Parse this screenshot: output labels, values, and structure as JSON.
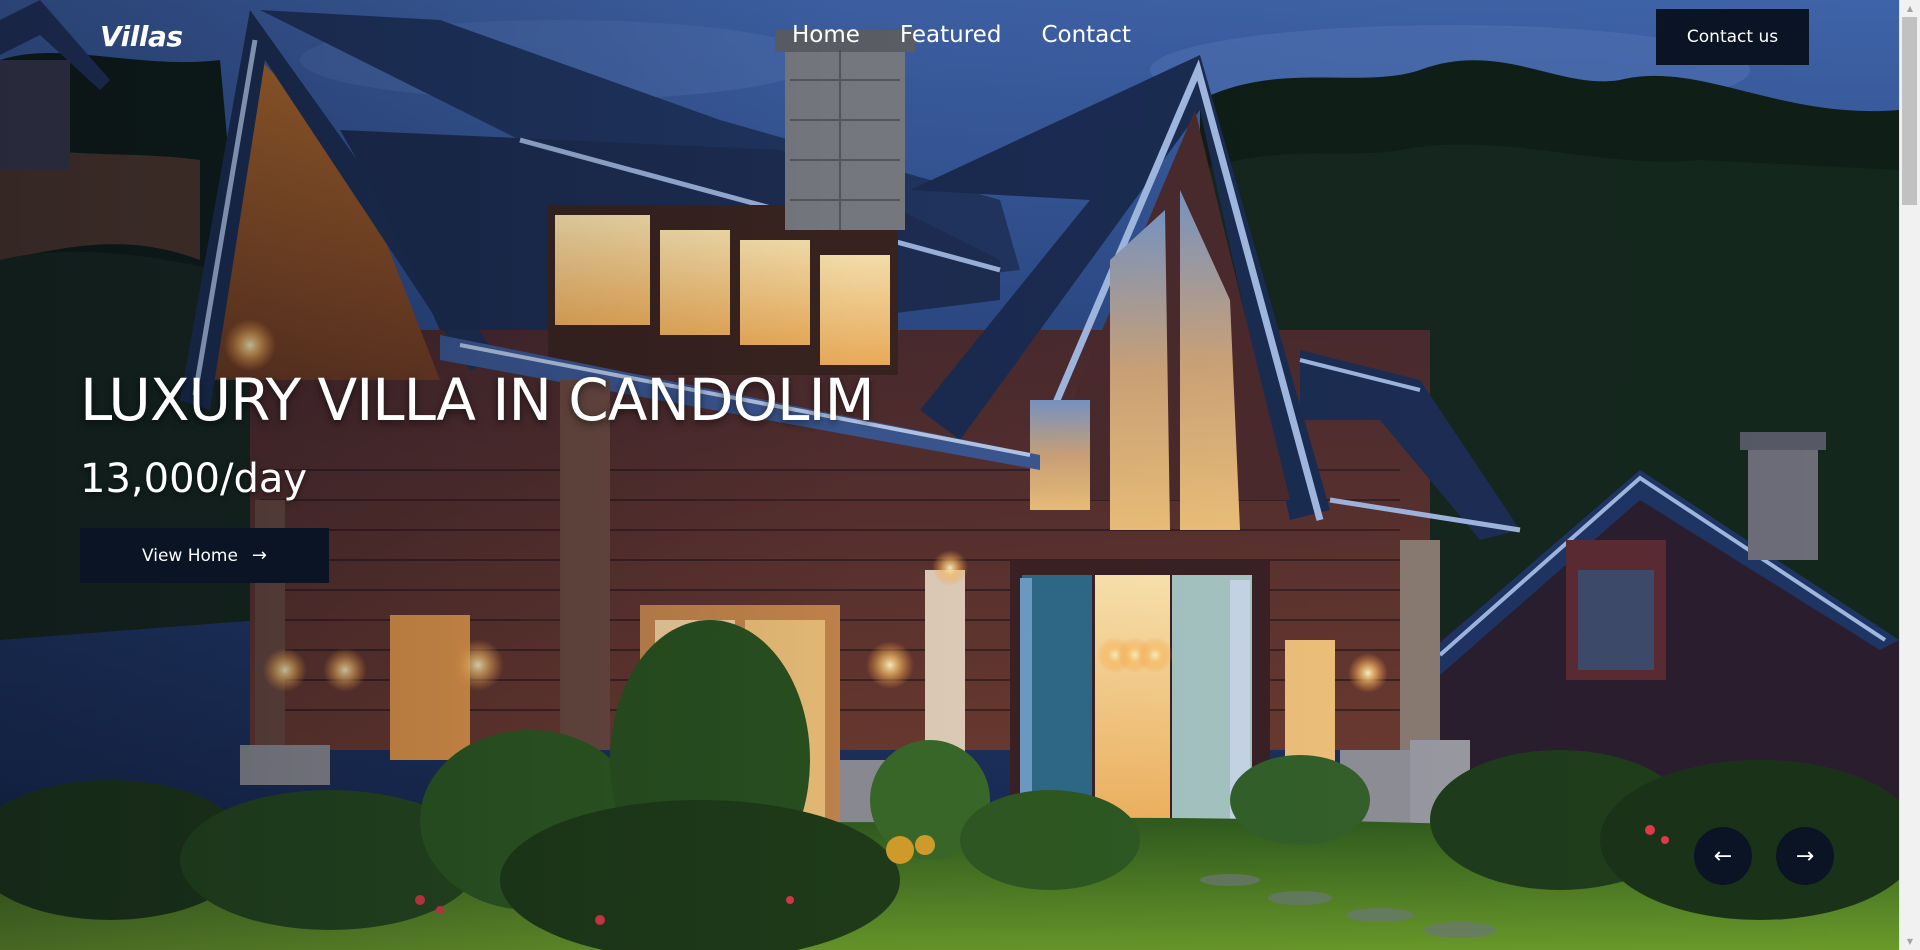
{
  "brand": {
    "name": "Villas"
  },
  "nav": {
    "items": [
      {
        "label": "Home"
      },
      {
        "label": "Featured"
      },
      {
        "label": "Contact"
      }
    ],
    "contact_button": "Contact us"
  },
  "hero": {
    "title": "LUXURY VILLA IN CANDOLIM",
    "price": "13,000/day",
    "cta_label": "View Home",
    "cta_icon": "arrow-right-icon",
    "image_subject": "villa-at-dusk-photo"
  },
  "slider": {
    "prev_icon": "arrow-left-icon",
    "next_icon": "arrow-right-icon"
  },
  "icons": {
    "arrow_left": "←",
    "arrow_right": "→",
    "scroll_up": "▲",
    "scroll_down": "▼"
  },
  "colors": {
    "button_bg": "#0a1424",
    "text": "#ffffff",
    "scrollbar_track": "#f1f1f1",
    "scrollbar_thumb": "#c1c1c1"
  }
}
